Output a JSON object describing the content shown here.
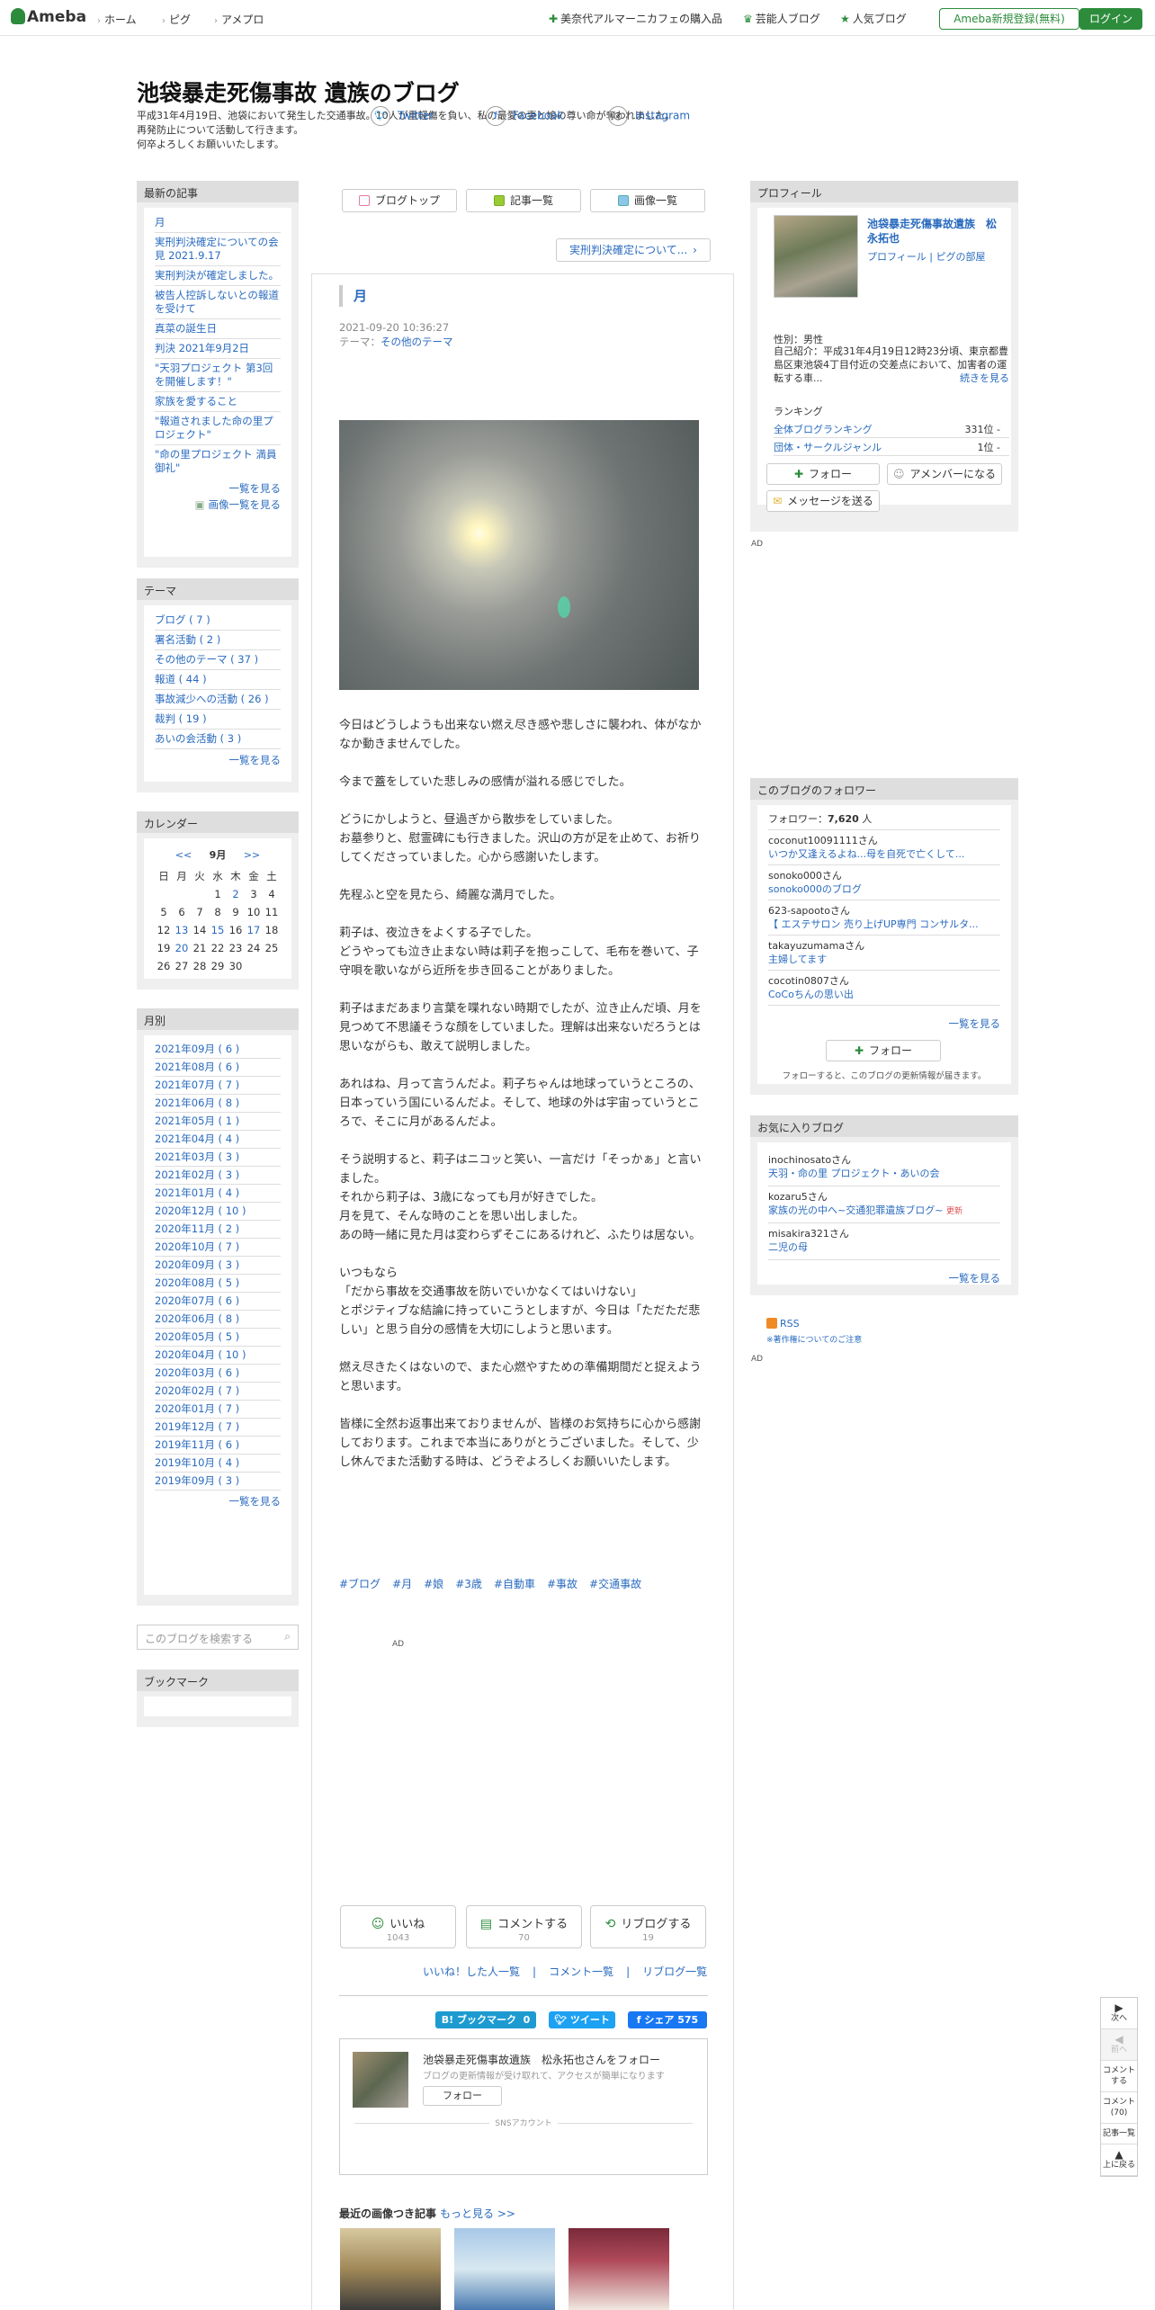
{
  "topbar": {
    "logo": "Ameba",
    "nav": [
      "ホーム",
      "ピグ",
      "アメプロ"
    ],
    "right_links": [
      "美奈代アルマーニカフェの購入品",
      "芸能人ブログ",
      "人気ブログ"
    ],
    "register_label": "Ameba新規登録(無料)",
    "login_label": "ログイン"
  },
  "header": {
    "title": "池袋暴走死傷事故 遺族のブログ",
    "description": [
      "平成31年4月19日、池袋において発生した交通事故。10人が重軽傷を負い、私の最愛の妻と娘の尊い命が奪われました。",
      "再発防止について活動して行きます。",
      "何卒よろしくお願いいたします。"
    ]
  },
  "left": {
    "recent": {
      "title": "最新の記事",
      "items": [
        "月",
        "実刑判決確定についての会見 2021.9.17",
        "実刑判決が確定しました。",
        "被告人控訴しないとの報道を受けて",
        "真菜の誕生日",
        "判決 2021年9月2日",
        "\"天羽プロジェクト 第3回を開催します！\"",
        "家族を愛すること",
        "\"報道されました命の里プロジェクト\"",
        "\"命の里プロジェクト 満員御礼\""
      ],
      "more": "一覧を見る",
      "images": "画像一覧を見る"
    },
    "themes": {
      "title": "テーマ",
      "items": [
        "ブログ ( 7 )",
        "署名活動 ( 2 )",
        "その他のテーマ ( 37 )",
        "報道 ( 44 )",
        "事故減少への活動 ( 26 )",
        "裁判 ( 19 )",
        "あいの会活動 ( 3 )"
      ],
      "more": "一覧を見る"
    },
    "calendar": {
      "title": "カレンダー",
      "prev": "<<",
      "month": "9月",
      "next": ">>",
      "weekdays": [
        "日",
        "月",
        "火",
        "水",
        "木",
        "金",
        "土"
      ],
      "weeks": [
        [
          "",
          "",
          "",
          "1",
          "2",
          "3",
          "4"
        ],
        [
          "5",
          "6",
          "7",
          "8",
          "9",
          "10",
          "11"
        ],
        [
          "12",
          "13",
          "14",
          "15",
          "16",
          "17",
          "18"
        ],
        [
          "19",
          "20",
          "21",
          "22",
          "23",
          "24",
          "25"
        ],
        [
          "26",
          "27",
          "28",
          "29",
          "30",
          "",
          ""
        ]
      ],
      "linked_days": [
        "2",
        "13",
        "15",
        "17",
        "20"
      ]
    },
    "archive": {
      "title": "月別",
      "items": [
        "2021年09月 ( 6 )",
        "2021年08月 ( 6 )",
        "2021年07月 ( 7 )",
        "2021年06月 ( 8 )",
        "2021年05月 ( 1 )",
        "2021年04月 ( 4 )",
        "2021年03月 ( 3 )",
        "2021年02月 ( 3 )",
        "2021年01月 ( 4 )",
        "2020年12月 ( 10 )",
        "2020年11月 ( 2 )",
        "2020年10月 ( 7 )",
        "2020年09月 ( 3 )",
        "2020年08月 ( 5 )",
        "2020年07月 ( 6 )",
        "2020年06月 ( 8 )",
        "2020年05月 ( 5 )",
        "2020年04月 ( 10 )",
        "2020年03月 ( 6 )",
        "2020年02月 ( 7 )",
        "2020年01月 ( 7 )",
        "2019年12月 ( 7 )",
        "2019年11月 ( 6 )",
        "2019年10月 ( 4 )",
        "2019年09月 ( 3 )"
      ],
      "more": "一覧を見る"
    },
    "search_placeholder": "このブログを検索する",
    "bookmark_title": "ブックマーク"
  },
  "main": {
    "tabs": [
      "ブログトップ",
      "記事一覧",
      "画像一覧"
    ],
    "prev_link": "実刑判決確定について...",
    "post": {
      "title": "月",
      "date": "2021-09-20 10:36:27",
      "theme_label": "テーマ：",
      "theme": "その他のテーマ",
      "paragraphs": [
        "今日はどうしようも出来ない燃え尽き感や悲しさに襲われ、体がなかなか動きませんでした。",
        "今まで蓋をしていた悲しみの感情が溢れる感じでした。",
        "どうにかしようと、昼過ぎから散歩をしていました。\nお墓参りと、慰霊碑にも行きました。沢山の方が足を止めて、お祈りしてくださっていました。心から感謝いたします。",
        "先程ふと空を見たら、綺麗な満月でした。",
        "莉子は、夜泣きをよくする子でした。\nどうやっても泣き止まない時は莉子を抱っこして、毛布を巻いて、子守唄を歌いながら近所を歩き回ることがありました。",
        "莉子はまだあまり言葉を喋れない時期でしたが、泣き止んだ頃、月を見つめて不思議そうな顔をしていました。理解は出来ないだろうとは思いながらも、敢えて説明しました。",
        "あれはね、月って言うんだよ。莉子ちゃんは地球っていうところの、日本っていう国にいるんだよ。そして、地球の外は宇宙っていうところで、そこに月があるんだよ。",
        "そう説明すると、莉子はニコッと笑い、一言だけ「そっかぁ」と言いました。\nそれから莉子は、3歳になっても月が好きでした。\n月を見て、そんな時のことを思い出しました。\nあの時一緒に見た月は変わらずそこにあるけれど、ふたりは居ない。",
        "いつもなら\n「だから事故を交通事故を防いでいかなくてはいけない」\nとポジティブな結論に持っていこうとしますが、今日は「ただただ悲しい」と思う自分の感情を大切にしようと思います。",
        "燃え尽きたくはないので、また心燃やすための準備期間だと捉えようと思います。",
        "皆様に全然お返事出来ておりませんが、皆様のお気持ちに心から感謝しております。これまで本当にありがとうございました。そして、少し休んでまた活動する時は、どうぞよろしくお願いいたします。"
      ],
      "hashtags": [
        "#ブログ",
        "#月",
        "#娘",
        "#3歳",
        "#自動車",
        "#事故",
        "#交通事故"
      ]
    },
    "ad_label": "AD",
    "reactions": {
      "like": {
        "label": "いいね",
        "count": "1043"
      },
      "comment": {
        "label": "コメントする",
        "count": "70"
      },
      "reblog": {
        "label": "リブログする",
        "count": "19"
      }
    },
    "reaction_links": [
      "いいね！した人一覧",
      "コメント一覧",
      "リブログ一覧"
    ],
    "share": {
      "bookmark": "B! ブックマーク",
      "bookmark_count": "0",
      "tweet": "ツイート",
      "facebook": "シェア",
      "facebook_count": "575"
    },
    "follow_card": {
      "name": "池袋暴走死傷事故遺族　松永拓也さんをフォロー",
      "sub": "ブログの更新情報が受け取れて、アクセスが簡単になります",
      "button": "フォロー",
      "sns_label": "SNSアカウント",
      "sns": [
        "Twitter",
        "Facebook",
        "Instagram"
      ]
    },
    "recent_images": {
      "title": "最近の画像つき記事",
      "more": "もっと見る >>"
    }
  },
  "right": {
    "profile": {
      "title": "プロフィール",
      "name": "池袋暴走死傷事故遺族　松永拓也",
      "links": [
        "プロフィール",
        "ピグの部屋"
      ],
      "gender": "性別：男性",
      "intro": "自己紹介：平成31年4月19日12時23分頃、東京都豊島区東池袋4丁目付近の交差点において、加害者の運転する車...",
      "intro_more": "続きを見る",
      "ranking_label": "ランキング",
      "rankings": [
        {
          "name": "全体ブログランキング",
          "value": "331位 -"
        },
        {
          "name": "団体・サークルジャンル",
          "value": "1位 -"
        }
      ],
      "buttons": [
        "フォロー",
        "アメンバーになる",
        "メッセージを送る"
      ]
    },
    "ad_label": "AD",
    "followers": {
      "title": "このブログのフォロワー",
      "count_label": "フォロワー：",
      "count": "7,620",
      "count_unit": "人",
      "items": [
        {
          "user": "coconut10091111さん",
          "blog": "いつか又逢えるよね...母を自死で亡くして..."
        },
        {
          "user": "sonoko000さん",
          "blog": "sonoko000のブログ"
        },
        {
          "user": "623-sapootoさん",
          "blog": "【 エステサロン 売り上げUP専門 コンサルタ..."
        },
        {
          "user": "takayuzumamaさん",
          "blog": "主婦してます"
        },
        {
          "user": "cocotin0807さん",
          "blog": "CoCoちんの思い出"
        }
      ],
      "more": "一覧を見る",
      "button": "フォロー",
      "note": "フォローすると、このブログの更新情報が届きます。"
    },
    "favorites": {
      "title": "お気に入りブログ",
      "items": [
        {
          "user": "inochinosatoさん",
          "blog": "天羽・命の里 プロジェクト・あいの会",
          "new": ""
        },
        {
          "user": "kozaru5さん",
          "blog": "家族の光の中へ~交通犯罪遺族ブログ~",
          "new": "更新"
        },
        {
          "user": "misakira321さん",
          "blog": "二児の母",
          "new": ""
        }
      ],
      "more": "一覧を見る"
    },
    "rss": "RSS",
    "rss_note": "※著作権についてのご注意"
  },
  "sidenav": [
    {
      "icon": "▶",
      "label": "次へ"
    },
    {
      "icon": "◀",
      "label": "前へ"
    },
    {
      "icon": "",
      "label": "コメントする"
    },
    {
      "icon": "",
      "label": "コメント(70)"
    },
    {
      "icon": "",
      "label": "記事一覧"
    },
    {
      "icon": "▲",
      "label": "上に戻る"
    }
  ],
  "colors": {
    "accent": "#2d8c3c",
    "link": "#2a6bbf"
  }
}
